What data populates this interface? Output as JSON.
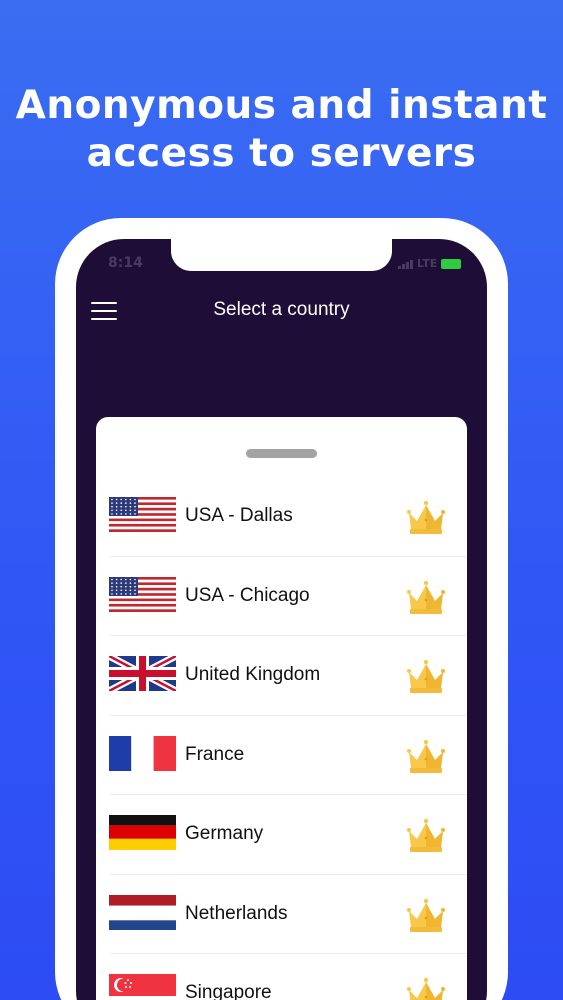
{
  "headline": {
    "line1": "Anonymous and instant",
    "line2": "access to servers"
  },
  "status_bar": {
    "time": "8:14",
    "network": "LTE"
  },
  "nav": {
    "title": "Select a country",
    "menu_icon": "hamburger-menu-icon"
  },
  "countries": [
    {
      "name": "USA - Dallas",
      "flag": "us",
      "premium_icon": "crown-icon"
    },
    {
      "name": "USA - Chicago",
      "flag": "us",
      "premium_icon": "crown-icon"
    },
    {
      "name": "United Kingdom",
      "flag": "uk",
      "premium_icon": "crown-icon"
    },
    {
      "name": "France",
      "flag": "fr",
      "premium_icon": "crown-icon"
    },
    {
      "name": "Germany",
      "flag": "de",
      "premium_icon": "crown-icon"
    },
    {
      "name": "Netherlands",
      "flag": "nl",
      "premium_icon": "crown-icon"
    },
    {
      "name": "Singapore",
      "flag": "sg",
      "premium_icon": "crown-icon"
    }
  ],
  "colors": {
    "background": "#3056f5",
    "screen": "#1e0d36",
    "crown": "#f5c542"
  }
}
